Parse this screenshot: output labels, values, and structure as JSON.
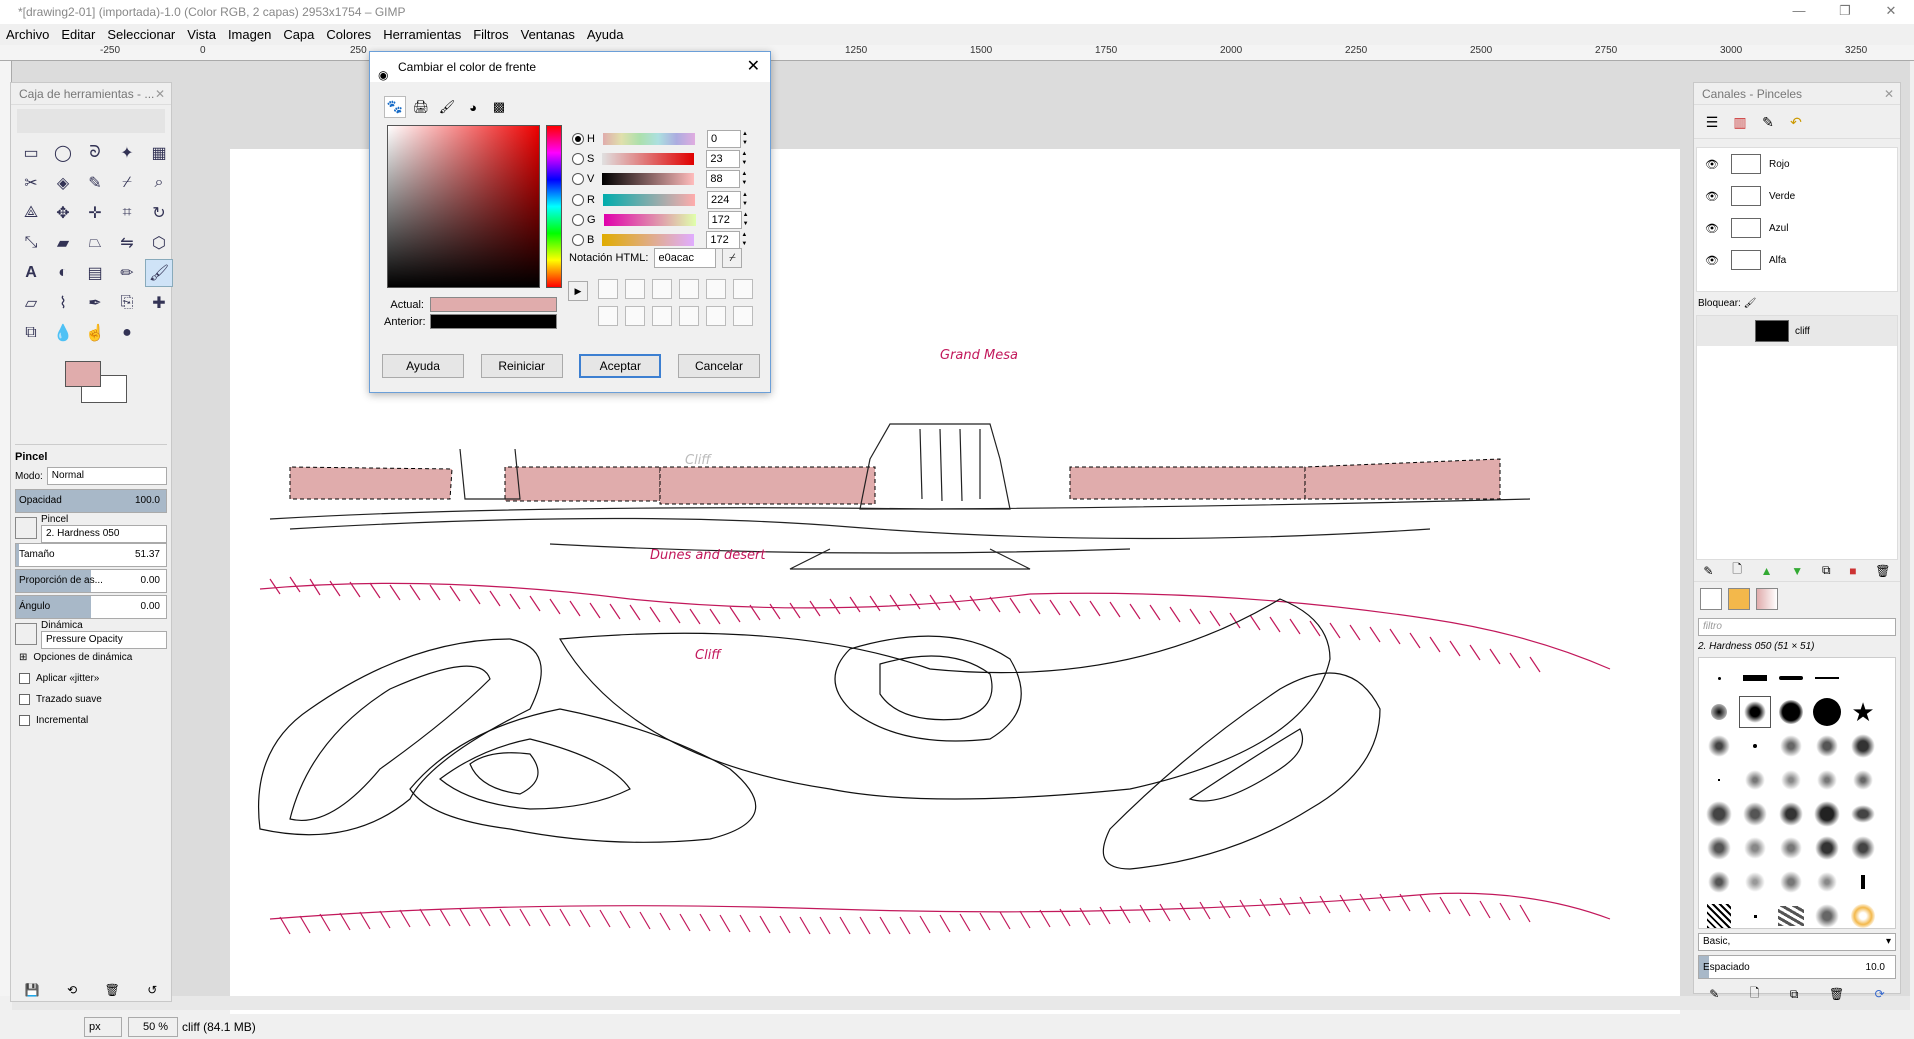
{
  "window": {
    "title": "*[drawing2-01] (importada)-1.0 (Color RGB, 2 capas) 2953x1754 – GIMP",
    "controls": [
      "—",
      "❐",
      "✕"
    ]
  },
  "menu": [
    "Archivo",
    "Editar",
    "Seleccionar",
    "Vista",
    "Imagen",
    "Capa",
    "Colores",
    "Herramientas",
    "Filtros",
    "Ventanas",
    "Ayuda"
  ],
  "ruler": {
    "ticks": [
      "-250",
      "0",
      "250",
      "1250",
      "1500",
      "1750",
      "2000",
      "2250",
      "2500",
      "2750",
      "3000",
      "3250"
    ]
  },
  "toolbox": {
    "title": "Caja de herramientas - ...",
    "fg_color": "#e0acac",
    "tool_options": {
      "title": "Pincel",
      "mode_label": "Modo:",
      "mode_value": "Normal",
      "opacity_label": "Opacidad",
      "opacity_value": "100.0",
      "brush_label": "Pincel",
      "brush_value": "2. Hardness 050",
      "size_label": "Tamaño",
      "size_value": "51.37",
      "ratio_label": "Proporción de as...",
      "ratio_value": "0.00",
      "angle_label": "Ángulo",
      "angle_value": "0.00",
      "dynamics_label": "Dinámica",
      "dynamics_value": "Pressure Opacity",
      "dyn_options": "Opciones de dinámica",
      "jitter": "Aplicar «jitter»",
      "smooth": "Trazado suave",
      "incremental": "Incremental"
    }
  },
  "dialog": {
    "title": "Cambiar el color de frente",
    "channels": [
      {
        "label": "H",
        "value": "0"
      },
      {
        "label": "S",
        "value": "23"
      },
      {
        "label": "V",
        "value": "88"
      },
      {
        "label": "R",
        "value": "224"
      },
      {
        "label": "G",
        "value": "172"
      },
      {
        "label": "B",
        "value": "172"
      }
    ],
    "html_label": "Notación HTML:",
    "html_value": "e0acac",
    "current_label": "Actual:",
    "previous_label": "Anterior:",
    "current_color": "#e0acac",
    "previous_color": "#000000",
    "buttons": {
      "help": "Ayuda",
      "reset": "Reiniciar",
      "ok": "Aceptar",
      "cancel": "Cancelar"
    }
  },
  "canvas": {
    "annotations": [
      "Grand Mesa",
      "Cliff",
      "Dunes and desert",
      "Cliff"
    ]
  },
  "dock": {
    "title": "Canales - Pinceles",
    "channels": [
      "Rojo",
      "Verde",
      "Azul",
      "Alfa"
    ],
    "lock_label": "Bloquear:",
    "mask_name": "cliff",
    "filter_placeholder": "filtro",
    "brush_name": "2. Hardness 050 (51 × 51)",
    "brush_set": "Basic,",
    "spacing_label": "Espaciado",
    "spacing_value": "10.0"
  },
  "status": {
    "unit": "px",
    "zoom": "50 %",
    "info": "cliff (84.1 MB)"
  }
}
